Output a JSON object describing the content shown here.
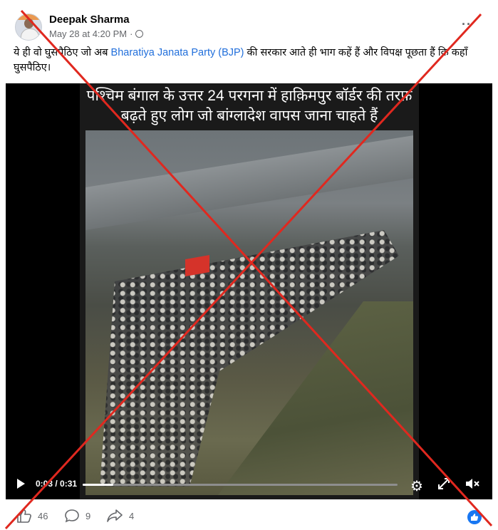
{
  "post": {
    "author": "Deepak Sharma",
    "timestamp": "May 28 at 4:20 PM",
    "separator": "·",
    "audience_icon": "globe-icon",
    "more_icon": "more-options-icon",
    "more_label": "··",
    "text_before": "ये ही वो घुसपैठिए जो अब ",
    "text_link": "Bharatiya Janata Party (BJP)",
    "text_after": " की सरकार आते ही भाग कहें हैं और विपक्ष पूछता हैं कि कहाँ घुसपैठिए।"
  },
  "video": {
    "caption": "पश्चिम बंगाल के उत्तर 24 परगना में हाक़िमपुर बॉर्डर की तरफ़ बढ़ते हुए लोग जो बांग्लादेश वापस जाना चाहते हैं",
    "time": "0:03 / 0:31",
    "progress": 0.097,
    "play_icon": "play-icon",
    "settings_icon": "gear-icon",
    "fullscreen_icon": "fullscreen-icon",
    "mute_icon": "mute-icon"
  },
  "reactions": {
    "likes": "46",
    "comments": "9",
    "shares": "4"
  },
  "overlay": {
    "x_color": "#e0281f"
  }
}
